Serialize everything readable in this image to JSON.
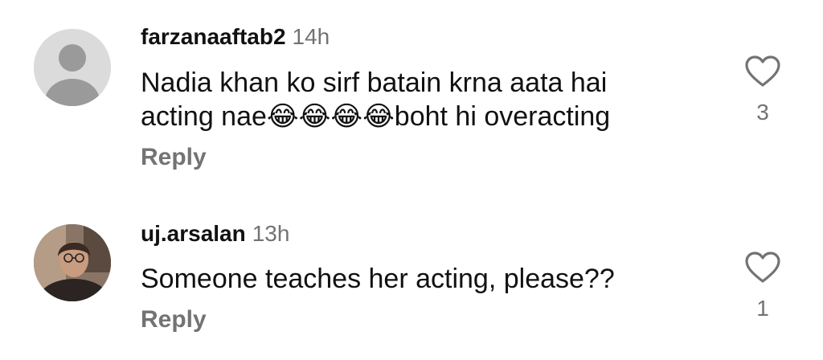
{
  "comments": [
    {
      "username": "farzanaaftab2",
      "time": "14h",
      "line1": "Nadia khan ko sirf batain krna aata hai",
      "line2": "acting nae😂😂😂😂boht hi overacting",
      "reply_label": "Reply",
      "like_count": "3",
      "avatar": "default-avatar-icon"
    },
    {
      "username": "uj.arsalan",
      "time": "13h",
      "line1": "Someone teaches her acting, please??",
      "reply_label": "Reply",
      "like_count": "1",
      "avatar": "profile-photo"
    }
  ],
  "colors": {
    "primary_text": "#111111",
    "secondary_text": "#737373",
    "default_avatar_bg": "#dbdbdb",
    "default_avatar_fg": "#9a9a9a"
  }
}
